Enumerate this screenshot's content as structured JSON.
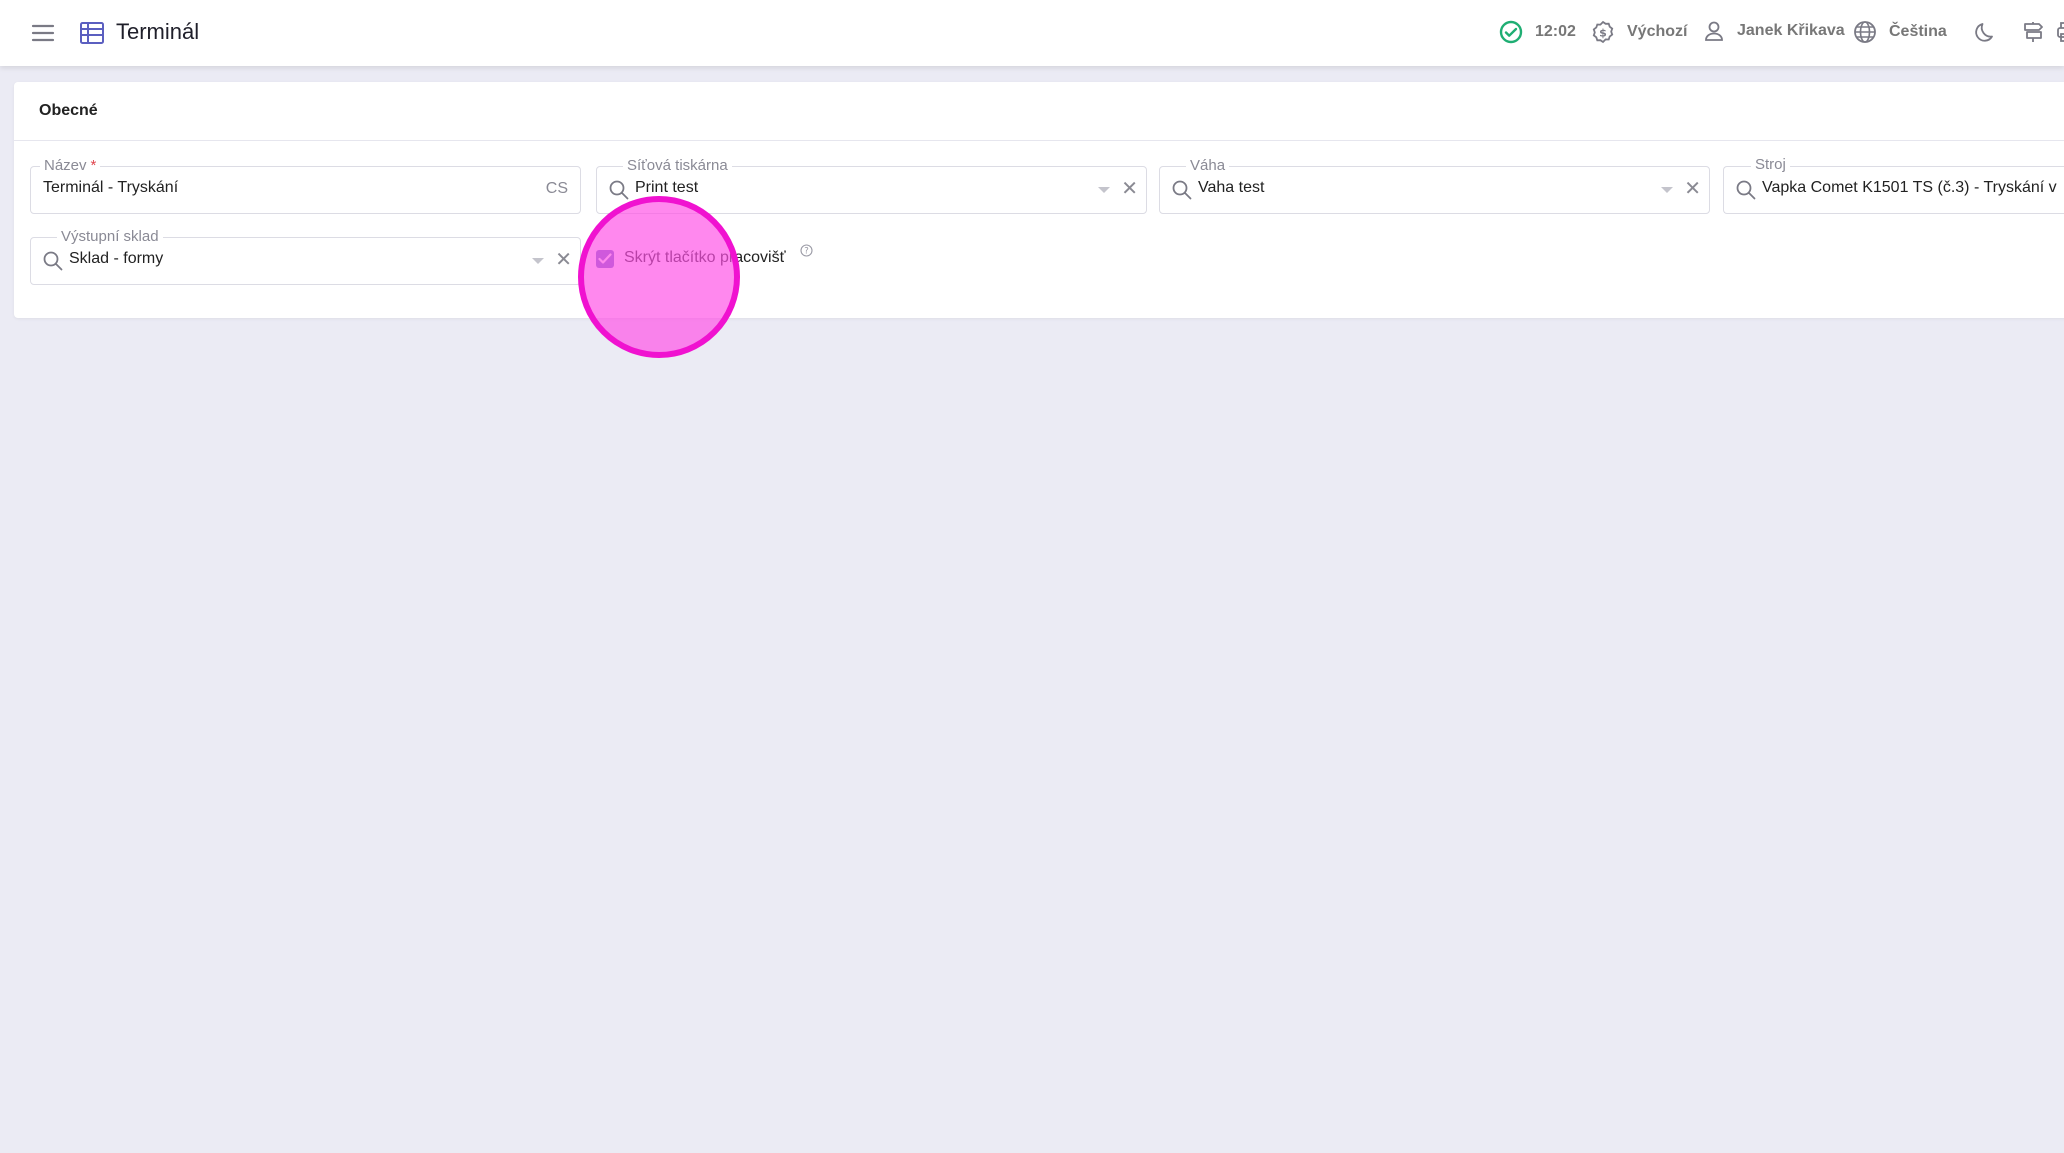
{
  "header": {
    "title": "Terminál",
    "status_time": "12:02",
    "currency": "Výchozí",
    "user": "Janek Křikava",
    "language": "Čeština"
  },
  "section": {
    "title": "Obecné"
  },
  "fields": {
    "name": {
      "label": "Název",
      "required_mark": "*",
      "value": "Terminál - Tryskání",
      "lang": "CS"
    },
    "printer": {
      "label": "Síťová tiskárna",
      "value": "Print test"
    },
    "scale": {
      "label": "Váha",
      "value": "Vaha test"
    },
    "machine": {
      "label": "Stroj",
      "value": "Vapka Comet K1501 TS (č.3) - Tryskání v"
    },
    "warehouse": {
      "label": "Výstupní sklad",
      "value": "Sklad - formy"
    }
  },
  "checkbox": {
    "label": "Skrýt tlačítko pracovišť",
    "checked": true
  },
  "colors": {
    "accent": "#6b6fc6",
    "status_ok": "#1fae73",
    "marker": "#f012d0"
  },
  "icons": [
    "menu-icon",
    "table-icon",
    "check-circle-icon",
    "currency-icon",
    "user-icon",
    "globe-icon",
    "moon-icon",
    "signpost-icon",
    "search-icon",
    "chevron-down-icon",
    "close-icon",
    "help-icon"
  ]
}
